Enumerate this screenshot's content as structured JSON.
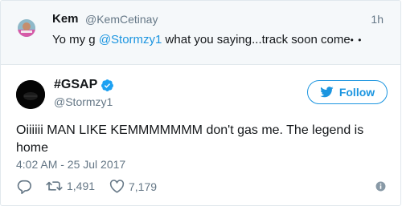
{
  "parent_tweet": {
    "name": "Kem",
    "handle": "@KemCetinay",
    "time": "1h",
    "text_before": "Yo my g ",
    "mention": "@Stormzy1",
    "text_after": " what you saying...track soon come",
    "ellipsis": "• •"
  },
  "main_tweet": {
    "display_name": "#GSAP",
    "handle": "@Stormzy1",
    "follow_label": "Follow",
    "text": "Oiiiiii MAN LIKE KEMMMMMMM don't gas me. The legend is home",
    "timestamp": "4:02 AM - 25 Jul 2017",
    "retweet_count": "1,491",
    "like_count": "7,179"
  },
  "colors": {
    "accent": "#1b95e0",
    "muted": "#657786",
    "text": "#14171a",
    "verified": "#1da1f2"
  },
  "icons": {
    "reply": "reply-icon",
    "retweet": "retweet-icon",
    "like": "heart-icon",
    "info": "info-icon",
    "verified": "verified-badge-icon",
    "follow": "twitter-bird-icon"
  }
}
